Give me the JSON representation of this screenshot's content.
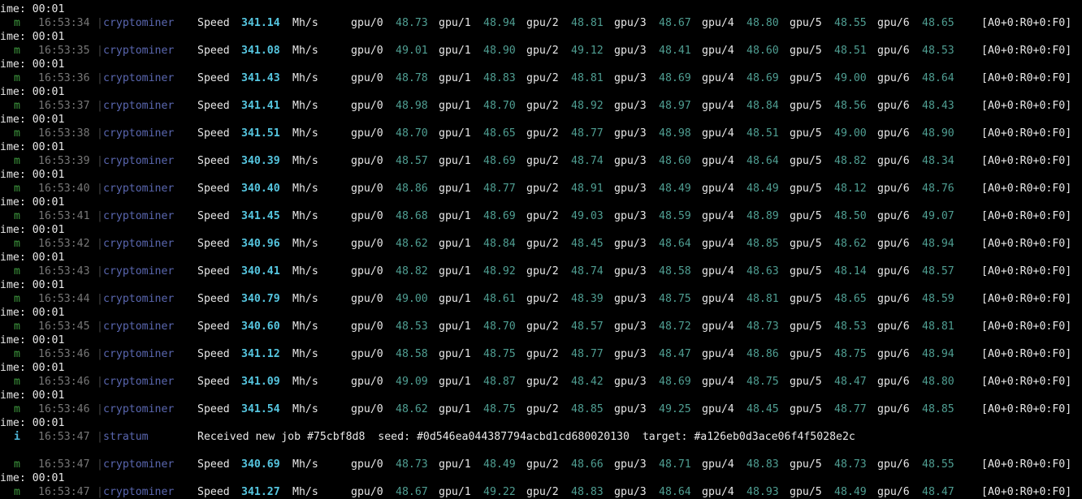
{
  "terminal": {
    "rows": [
      {
        "type": "hash",
        "tag": "m",
        "time": "16:53:34",
        "source": "cryptominer",
        "speed_label": "Speed",
        "speed": "341.14",
        "unit": "Mh/s",
        "gpus": [
          [
            "gpu/0",
            "48.73"
          ],
          [
            "gpu/1",
            "48.94"
          ],
          [
            "gpu/2",
            "48.81"
          ],
          [
            "gpu/3",
            "48.67"
          ],
          [
            "gpu/4",
            "48.80"
          ],
          [
            "gpu/5",
            "48.55"
          ],
          [
            "gpu/6",
            "48.65"
          ]
        ],
        "tail": "[A0+0:R0+0:F0]"
      },
      {
        "type": "hash",
        "tag": "m",
        "time": "16:53:35",
        "source": "cryptominer",
        "speed_label": "Speed",
        "speed": "341.08",
        "unit": "Mh/s",
        "gpus": [
          [
            "gpu/0",
            "49.01"
          ],
          [
            "gpu/1",
            "48.90"
          ],
          [
            "gpu/2",
            "49.12"
          ],
          [
            "gpu/3",
            "48.41"
          ],
          [
            "gpu/4",
            "48.60"
          ],
          [
            "gpu/5",
            "48.51"
          ],
          [
            "gpu/6",
            "48.53"
          ]
        ],
        "tail": "[A0+0:R0+0:F0]"
      },
      {
        "type": "hash",
        "tag": "m",
        "time": "16:53:36",
        "source": "cryptominer",
        "speed_label": "Speed",
        "speed": "341.43",
        "unit": "Mh/s",
        "gpus": [
          [
            "gpu/0",
            "48.78"
          ],
          [
            "gpu/1",
            "48.83"
          ],
          [
            "gpu/2",
            "48.81"
          ],
          [
            "gpu/3",
            "48.69"
          ],
          [
            "gpu/4",
            "48.69"
          ],
          [
            "gpu/5",
            "49.00"
          ],
          [
            "gpu/6",
            "48.64"
          ]
        ],
        "tail": "[A0+0:R0+0:F0]"
      },
      {
        "type": "hash",
        "tag": "m",
        "time": "16:53:37",
        "source": "cryptominer",
        "speed_label": "Speed",
        "speed": "341.41",
        "unit": "Mh/s",
        "gpus": [
          [
            "gpu/0",
            "48.98"
          ],
          [
            "gpu/1",
            "48.70"
          ],
          [
            "gpu/2",
            "48.92"
          ],
          [
            "gpu/3",
            "48.97"
          ],
          [
            "gpu/4",
            "48.84"
          ],
          [
            "gpu/5",
            "48.56"
          ],
          [
            "gpu/6",
            "48.43"
          ]
        ],
        "tail": "[A0+0:R0+0:F0]"
      },
      {
        "type": "hash",
        "tag": "m",
        "time": "16:53:38",
        "source": "cryptominer",
        "speed_label": "Speed",
        "speed": "341.51",
        "unit": "Mh/s",
        "gpus": [
          [
            "gpu/0",
            "48.70"
          ],
          [
            "gpu/1",
            "48.65"
          ],
          [
            "gpu/2",
            "48.77"
          ],
          [
            "gpu/3",
            "48.98"
          ],
          [
            "gpu/4",
            "48.51"
          ],
          [
            "gpu/5",
            "49.00"
          ],
          [
            "gpu/6",
            "48.90"
          ]
        ],
        "tail": "[A0+0:R0+0:F0]"
      },
      {
        "type": "hash",
        "tag": "m",
        "time": "16:53:39",
        "source": "cryptominer",
        "speed_label": "Speed",
        "speed": "340.39",
        "unit": "Mh/s",
        "gpus": [
          [
            "gpu/0",
            "48.57"
          ],
          [
            "gpu/1",
            "48.69"
          ],
          [
            "gpu/2",
            "48.74"
          ],
          [
            "gpu/3",
            "48.60"
          ],
          [
            "gpu/4",
            "48.64"
          ],
          [
            "gpu/5",
            "48.82"
          ],
          [
            "gpu/6",
            "48.34"
          ]
        ],
        "tail": "[A0+0:R0+0:F0]"
      },
      {
        "type": "hash",
        "tag": "m",
        "time": "16:53:40",
        "source": "cryptominer",
        "speed_label": "Speed",
        "speed": "340.40",
        "unit": "Mh/s",
        "gpus": [
          [
            "gpu/0",
            "48.86"
          ],
          [
            "gpu/1",
            "48.77"
          ],
          [
            "gpu/2",
            "48.91"
          ],
          [
            "gpu/3",
            "48.49"
          ],
          [
            "gpu/4",
            "48.49"
          ],
          [
            "gpu/5",
            "48.12"
          ],
          [
            "gpu/6",
            "48.76"
          ]
        ],
        "tail": "[A0+0:R0+0:F0]"
      },
      {
        "type": "hash",
        "tag": "m",
        "time": "16:53:41",
        "source": "cryptominer",
        "speed_label": "Speed",
        "speed": "341.45",
        "unit": "Mh/s",
        "gpus": [
          [
            "gpu/0",
            "48.68"
          ],
          [
            "gpu/1",
            "48.69"
          ],
          [
            "gpu/2",
            "49.03"
          ],
          [
            "gpu/3",
            "48.59"
          ],
          [
            "gpu/4",
            "48.89"
          ],
          [
            "gpu/5",
            "48.50"
          ],
          [
            "gpu/6",
            "49.07"
          ]
        ],
        "tail": "[A0+0:R0+0:F0]"
      },
      {
        "type": "hash",
        "tag": "m",
        "time": "16:53:42",
        "source": "cryptominer",
        "speed_label": "Speed",
        "speed": "340.96",
        "unit": "Mh/s",
        "gpus": [
          [
            "gpu/0",
            "48.62"
          ],
          [
            "gpu/1",
            "48.84"
          ],
          [
            "gpu/2",
            "48.45"
          ],
          [
            "gpu/3",
            "48.64"
          ],
          [
            "gpu/4",
            "48.85"
          ],
          [
            "gpu/5",
            "48.62"
          ],
          [
            "gpu/6",
            "48.94"
          ]
        ],
        "tail": "[A0+0:R0+0:F0]"
      },
      {
        "type": "hash",
        "tag": "m",
        "time": "16:53:43",
        "source": "cryptominer",
        "speed_label": "Speed",
        "speed": "340.41",
        "unit": "Mh/s",
        "gpus": [
          [
            "gpu/0",
            "48.82"
          ],
          [
            "gpu/1",
            "48.92"
          ],
          [
            "gpu/2",
            "48.74"
          ],
          [
            "gpu/3",
            "48.58"
          ],
          [
            "gpu/4",
            "48.63"
          ],
          [
            "gpu/5",
            "48.14"
          ],
          [
            "gpu/6",
            "48.57"
          ]
        ],
        "tail": "[A0+0:R0+0:F0]"
      },
      {
        "type": "hash",
        "tag": "m",
        "time": "16:53:44",
        "source": "cryptominer",
        "speed_label": "Speed",
        "speed": "340.79",
        "unit": "Mh/s",
        "gpus": [
          [
            "gpu/0",
            "49.00"
          ],
          [
            "gpu/1",
            "48.61"
          ],
          [
            "gpu/2",
            "48.39"
          ],
          [
            "gpu/3",
            "48.75"
          ],
          [
            "gpu/4",
            "48.81"
          ],
          [
            "gpu/5",
            "48.65"
          ],
          [
            "gpu/6",
            "48.59"
          ]
        ],
        "tail": "[A0+0:R0+0:F0]"
      },
      {
        "type": "hash",
        "tag": "m",
        "time": "16:53:45",
        "source": "cryptominer",
        "speed_label": "Speed",
        "speed": "340.60",
        "unit": "Mh/s",
        "gpus": [
          [
            "gpu/0",
            "48.53"
          ],
          [
            "gpu/1",
            "48.70"
          ],
          [
            "gpu/2",
            "48.57"
          ],
          [
            "gpu/3",
            "48.72"
          ],
          [
            "gpu/4",
            "48.73"
          ],
          [
            "gpu/5",
            "48.53"
          ],
          [
            "gpu/6",
            "48.81"
          ]
        ],
        "tail": "[A0+0:R0+0:F0]"
      },
      {
        "type": "hash",
        "tag": "m",
        "time": "16:53:46",
        "source": "cryptominer",
        "speed_label": "Speed",
        "speed": "341.12",
        "unit": "Mh/s",
        "gpus": [
          [
            "gpu/0",
            "48.58"
          ],
          [
            "gpu/1",
            "48.75"
          ],
          [
            "gpu/2",
            "48.77"
          ],
          [
            "gpu/3",
            "48.47"
          ],
          [
            "gpu/4",
            "48.86"
          ],
          [
            "gpu/5",
            "48.75"
          ],
          [
            "gpu/6",
            "48.94"
          ]
        ],
        "tail": "[A0+0:R0+0:F0]"
      },
      {
        "type": "hash",
        "tag": "m",
        "time": "16:53:46",
        "source": "cryptominer",
        "speed_label": "Speed",
        "speed": "341.09",
        "unit": "Mh/s",
        "gpus": [
          [
            "gpu/0",
            "49.09"
          ],
          [
            "gpu/1",
            "48.87"
          ],
          [
            "gpu/2",
            "48.42"
          ],
          [
            "gpu/3",
            "48.69"
          ],
          [
            "gpu/4",
            "48.75"
          ],
          [
            "gpu/5",
            "48.47"
          ],
          [
            "gpu/6",
            "48.80"
          ]
        ],
        "tail": "[A0+0:R0+0:F0]"
      },
      {
        "type": "hash",
        "tag": "m",
        "time": "16:53:46",
        "source": "cryptominer",
        "speed_label": "Speed",
        "speed": "341.54",
        "unit": "Mh/s",
        "gpus": [
          [
            "gpu/0",
            "48.62"
          ],
          [
            "gpu/1",
            "48.75"
          ],
          [
            "gpu/2",
            "48.85"
          ],
          [
            "gpu/3",
            "49.25"
          ],
          [
            "gpu/4",
            "48.45"
          ],
          [
            "gpu/5",
            "48.77"
          ],
          [
            "gpu/6",
            "48.85"
          ]
        ],
        "tail": "[A0+0:R0+0:F0]"
      },
      {
        "type": "job",
        "tag": "i",
        "time": "16:53:47",
        "source": "stratum",
        "message": "Received new job #75cbf8d8  seed: #0d546ea044387794acbd1cd680020130  target: #a126eb0d3ace06f4f5028e2c"
      },
      {
        "type": "hash",
        "tag": "m",
        "time": "16:53:47",
        "source": "cryptominer",
        "speed_label": "Speed",
        "speed": "340.69",
        "unit": "Mh/s",
        "gpus": [
          [
            "gpu/0",
            "48.73"
          ],
          [
            "gpu/1",
            "48.49"
          ],
          [
            "gpu/2",
            "48.66"
          ],
          [
            "gpu/3",
            "48.71"
          ],
          [
            "gpu/4",
            "48.83"
          ],
          [
            "gpu/5",
            "48.73"
          ],
          [
            "gpu/6",
            "48.55"
          ]
        ],
        "tail": "[A0+0:R0+0:F0]"
      },
      {
        "type": "hash",
        "tag": "m",
        "time": "16:53:47",
        "source": "cryptominer",
        "speed_label": "Speed",
        "speed": "341.27",
        "unit": "Mh/s",
        "gpus": [
          [
            "gpu/0",
            "48.67"
          ],
          [
            "gpu/1",
            "49.22"
          ],
          [
            "gpu/2",
            "48.83"
          ],
          [
            "gpu/3",
            "48.64"
          ],
          [
            "gpu/4",
            "48.93"
          ],
          [
            "gpu/5",
            "48.49"
          ],
          [
            "gpu/6",
            "48.47"
          ]
        ],
        "tail": "[A0+0:R0+0:F0]"
      }
    ],
    "elapsed_text": "ime: 00:01"
  }
}
